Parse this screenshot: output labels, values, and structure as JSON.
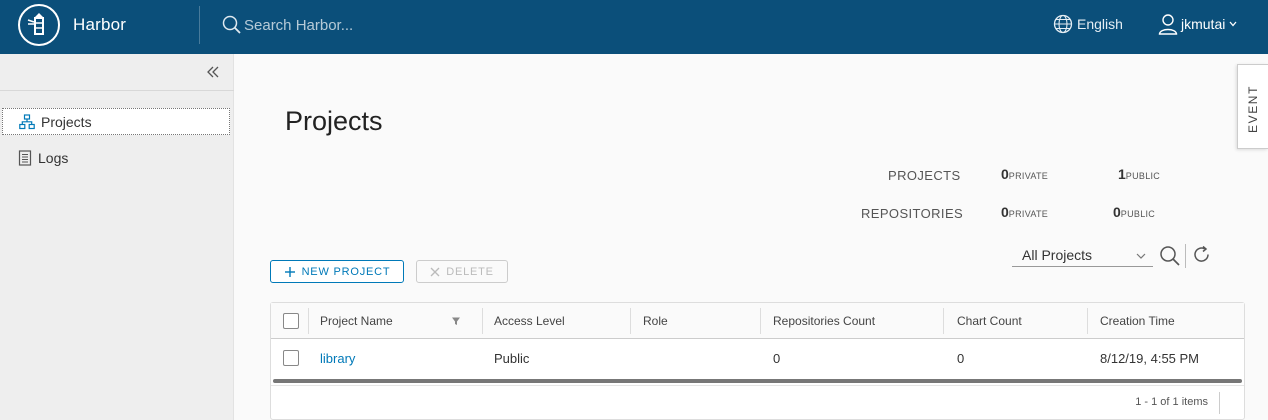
{
  "header": {
    "brand": "Harbor",
    "search_placeholder": "Search Harbor...",
    "language": "English",
    "username": "jkmutai"
  },
  "sidebar": {
    "items": [
      {
        "label": "Projects",
        "icon": "projects-icon",
        "active": true
      },
      {
        "label": "Logs",
        "icon": "logs-icon",
        "active": false
      }
    ]
  },
  "main": {
    "title": "Projects",
    "stats": {
      "projects_label": "PROJECTS",
      "repositories_label": "REPOSITORIES",
      "projects_private": "0",
      "projects_public": "1",
      "repos_private": "0",
      "repos_public": "0",
      "private_label": "PRIVATE",
      "public_label": "PUBLIC"
    },
    "toolbar": {
      "new_project": "NEW PROJECT",
      "delete": "DELETE",
      "filter_value": "All Projects"
    },
    "table": {
      "columns": [
        "Project Name",
        "Access Level",
        "Role",
        "Repositories Count",
        "Chart Count",
        "Creation Time"
      ],
      "rows": [
        {
          "name": "library",
          "access": "Public",
          "role": "",
          "repos": "0",
          "charts": "0",
          "created": "8/12/19, 4:55 PM"
        }
      ],
      "footer": "1 - 1 of 1 items"
    }
  },
  "event_tab": "EVENT",
  "colors": {
    "header_bg": "#0b4f7a",
    "accent": "#0079b8"
  }
}
